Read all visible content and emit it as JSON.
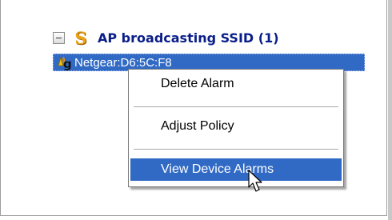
{
  "tree": {
    "group": {
      "title": "AP broadcasting SSID (1)",
      "icon": "s-shape-icon",
      "expander": "collapse"
    },
    "selected_item": {
      "label": "Netgear:D6:5C:F8",
      "icon": "wireless-ap-g-icon"
    }
  },
  "context_menu": {
    "items": [
      {
        "label": "Delete Alarm"
      },
      {
        "label": "Adjust Policy"
      },
      {
        "label": "View Device Alarms"
      }
    ],
    "highlighted_index": 2
  },
  "colors": {
    "selection": "#316ac5",
    "group_title": "#0a1e8a",
    "s_icon": "#e8a317"
  }
}
